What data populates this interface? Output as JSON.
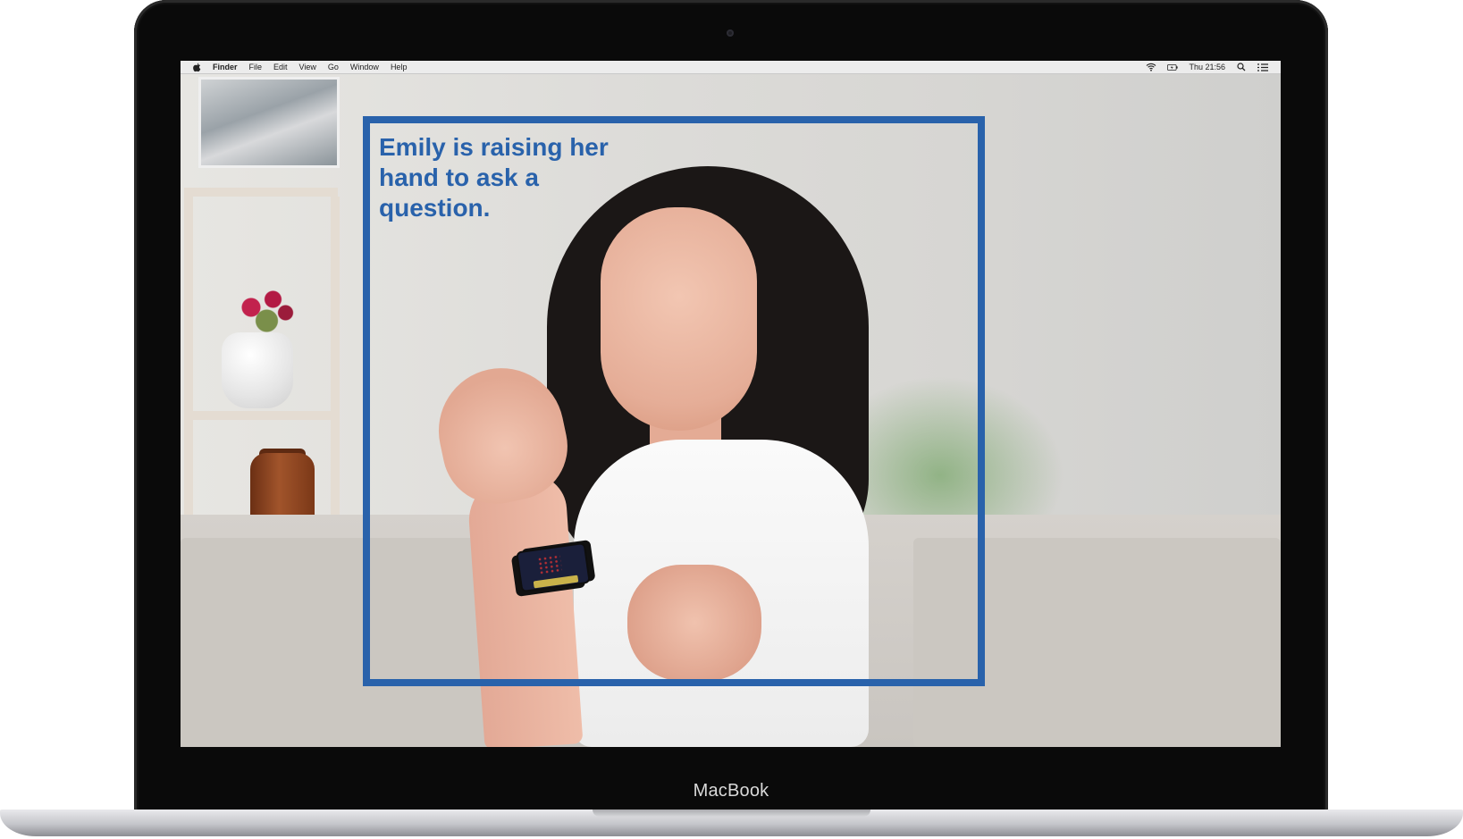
{
  "menubar": {
    "app_name": "Finder",
    "menus": [
      "File",
      "Edit",
      "View",
      "Go",
      "Window",
      "Help"
    ],
    "clock": "Thu 21:56",
    "status_icons": [
      "wifi-icon",
      "battery-icon",
      "search-icon",
      "list-icon"
    ]
  },
  "caption": {
    "text": "Emily is raising her hand to ask a question.",
    "color": "#2962ab"
  },
  "device": {
    "label": "MacBook"
  }
}
